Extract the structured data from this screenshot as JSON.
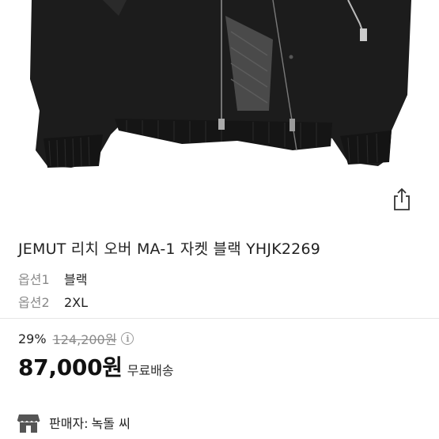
{
  "product": {
    "title": "JEMUT 리치 오버 MA-1 자켓 블랙 YHJK2269",
    "options": [
      {
        "label": "옵션1",
        "value": "블랙"
      },
      {
        "label": "옵션2",
        "value": "2XL"
      }
    ]
  },
  "pricing": {
    "discount": "29%",
    "original_price": "124,200원",
    "info_glyph": "i",
    "price": "87,000원",
    "shipping": "무료배송"
  },
  "seller": {
    "label": "판매자:",
    "name": "녹돌 씨"
  },
  "icons": {
    "share": "share-icon",
    "info": "info-icon",
    "store": "store-icon"
  }
}
